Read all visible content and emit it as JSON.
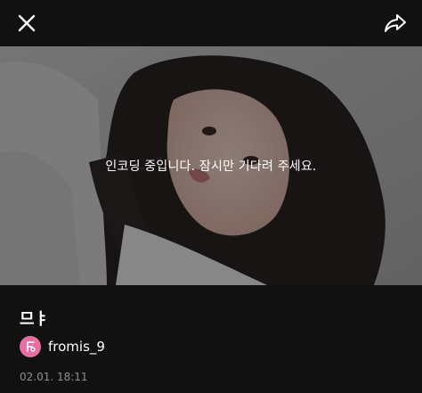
{
  "header": {
    "close_icon": "close-icon",
    "share_icon": "share-icon"
  },
  "media": {
    "status_text": "인코딩 중입니다. 잠시만 기다려 주세요."
  },
  "post": {
    "title": "므ㅑ",
    "author_name": "fromis_9",
    "timestamp": "02.01. 18:11"
  },
  "colors": {
    "background": "#111111",
    "avatar": "#e86fa3",
    "timestamp": "#8e8e8e"
  }
}
